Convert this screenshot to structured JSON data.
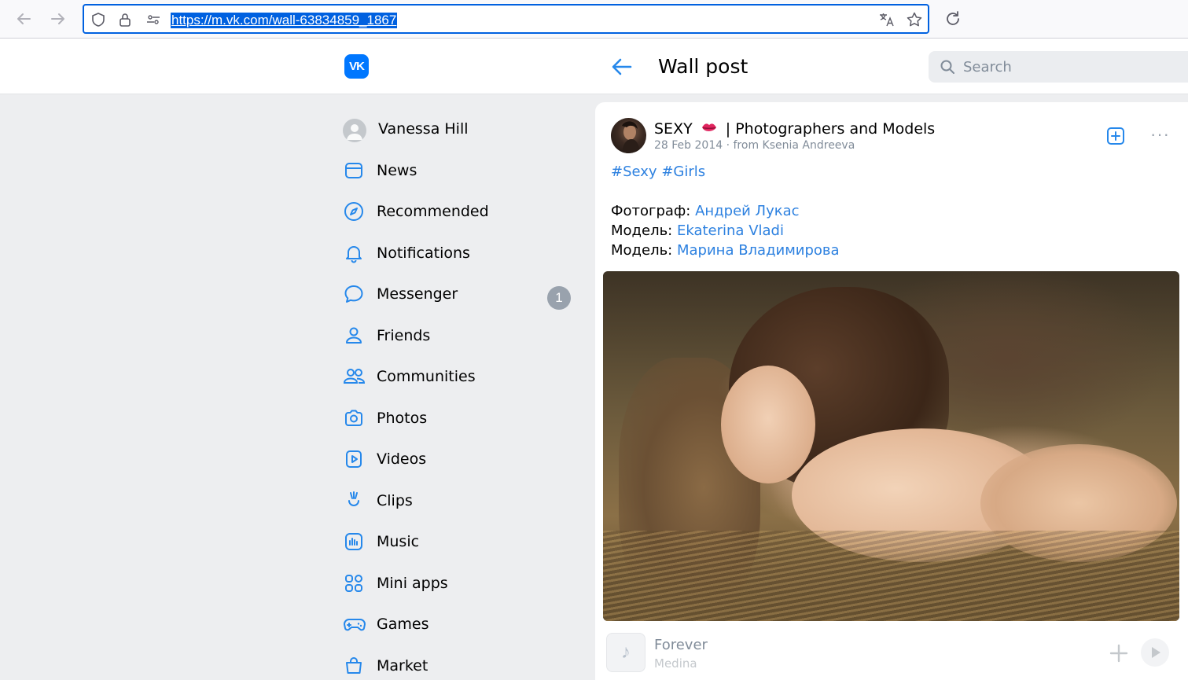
{
  "browser": {
    "url": "https://m.vk.com/wall-63834859_1867"
  },
  "header": {
    "logo_text": "VK",
    "title": "Wall post",
    "search_placeholder": "Search"
  },
  "sidebar": {
    "items": [
      {
        "label": "Vanessa Hill",
        "icon": "user-avatar"
      },
      {
        "label": "News",
        "icon": "news-icon"
      },
      {
        "label": "Recommended",
        "icon": "compass-icon"
      },
      {
        "label": "Notifications",
        "icon": "bell-icon"
      },
      {
        "label": "Messenger",
        "icon": "message-icon",
        "badge": "1"
      },
      {
        "label": "Friends",
        "icon": "user-icon"
      },
      {
        "label": "Communities",
        "icon": "users-icon"
      },
      {
        "label": "Photos",
        "icon": "camera-icon"
      },
      {
        "label": "Videos",
        "icon": "video-icon"
      },
      {
        "label": "Clips",
        "icon": "clips-icon"
      },
      {
        "label": "Music",
        "icon": "music-icon"
      },
      {
        "label": "Mini apps",
        "icon": "apps-icon"
      },
      {
        "label": "Games",
        "icon": "gamepad-icon"
      },
      {
        "label": "Market",
        "icon": "bag-icon"
      }
    ]
  },
  "post": {
    "author_name_prefix": "SEXY",
    "author_name_suffix": "| Photographers and Models",
    "date": "28 Feb 2014",
    "separator": "·",
    "from_text": "from Ksenia Andreeva",
    "hashtag1": "#Sexy",
    "hashtag2": "#Girls",
    "credits": [
      {
        "label": "Фотограф:",
        "name": "Андрей Лукас"
      },
      {
        "label": "Модель:",
        "name": "Ekaterina Vladi"
      },
      {
        "label": "Модель:",
        "name": "Марина Владимирова"
      }
    ],
    "more_glyph": "···"
  },
  "music": {
    "title": "Forever",
    "artist": "Medina",
    "note_glyph": "♪"
  },
  "colors": {
    "accent": "#2688eb",
    "link": "#2d81e0",
    "vk_blue": "#0077ff",
    "badge": "#99a2ad",
    "background": "#edeef0"
  }
}
